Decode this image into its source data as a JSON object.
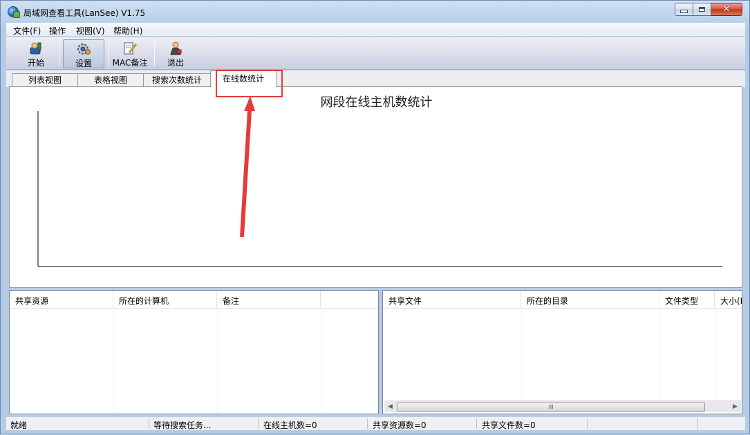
{
  "window": {
    "title": "局域网查看工具(LanSee) V1.75"
  },
  "menu": [
    "文件(F)",
    "操作",
    "视图(V)",
    "帮助(H)"
  ],
  "toolbar": {
    "start": "开始",
    "settings": "设置",
    "mac_note": "MAC备注",
    "exit": "退出"
  },
  "tabs": [
    "列表视图",
    "表格视图",
    "搜索次数统计",
    "在线数统计"
  ],
  "active_tab": "在线数统计",
  "chart_data": {
    "type": "bar",
    "title": "网段在线主机数统计",
    "categories": [],
    "values": []
  },
  "shares_table": {
    "columns": [
      "共享资源",
      "所在的计算机",
      "备注"
    ],
    "rows": []
  },
  "files_table": {
    "columns": [
      "共享文件",
      "所在的目录",
      "文件类型",
      "大小(K"
    ],
    "rows": [],
    "scroll_thumb_label": "III"
  },
  "status": {
    "ready": "就绪",
    "task": "等待搜索任务...",
    "online_hosts": "在线主机数=0",
    "share_count": "共享资源数=0",
    "file_count": "共享文件数=0"
  },
  "colors": {
    "annotation": "#e53b3b",
    "titlebar": "#b9d1ea"
  }
}
